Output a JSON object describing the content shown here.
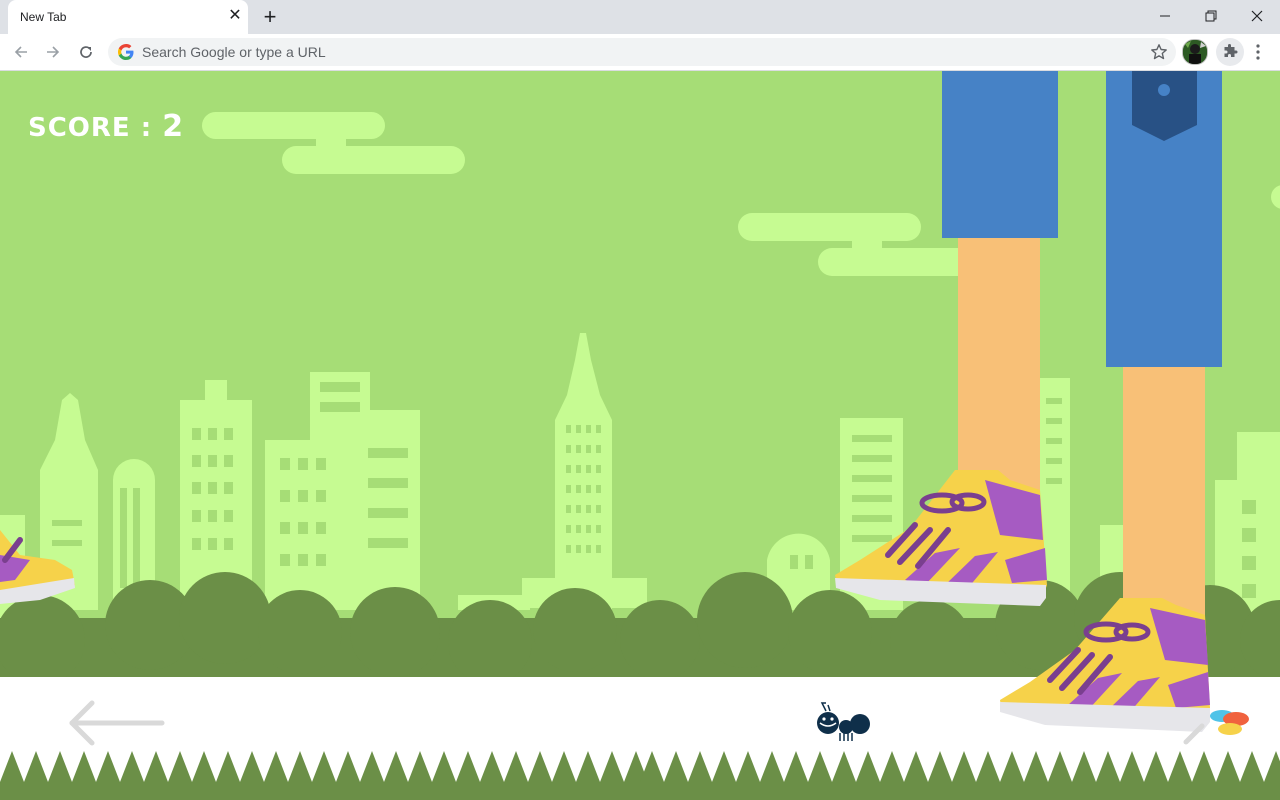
{
  "browser": {
    "tab_title": "New Tab",
    "omnibox_placeholder": "Search Google or type a URL"
  },
  "game": {
    "score_label": "SCORE : ",
    "score_value": "2"
  },
  "icons": {
    "back": "arrow-left-icon",
    "forward": "arrow-right-icon",
    "reload": "reload-icon",
    "star": "star-icon",
    "extensions": "puzzle-icon",
    "menu": "kebab-menu-icon",
    "left_control": "arrow-left-icon",
    "right_control": "arrow-right-icon"
  },
  "colors": {
    "sky": "#a6dd76",
    "cityscape": "#c6fb92",
    "bushes": "#6b8f47",
    "ground": "#ffffff",
    "jeans": "#4682c6",
    "skin": "#f8c077",
    "shoe_yellow": "#f6d24a",
    "shoe_purple": "#a65bc2",
    "ant": "#0f2f4a"
  }
}
